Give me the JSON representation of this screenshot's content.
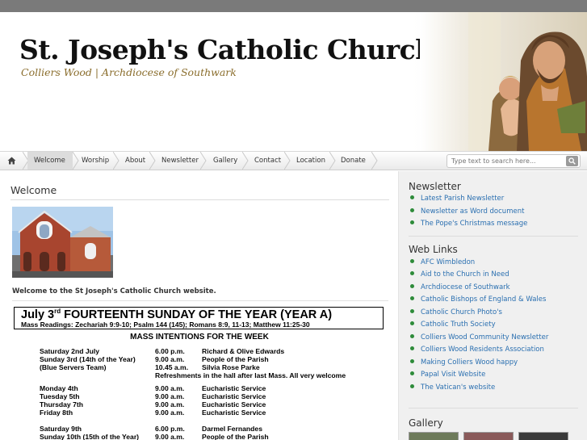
{
  "site": {
    "title": "St. Joseph's Catholic Church",
    "subtitle": "Colliers Wood | Archdiocese of Southwark"
  },
  "nav": {
    "home_icon": "home-icon",
    "items": [
      {
        "label": "Welcome",
        "active": true
      },
      {
        "label": "Worship"
      },
      {
        "label": "About"
      },
      {
        "label": "Newsletter"
      },
      {
        "label": "Gallery"
      },
      {
        "label": "Contact"
      },
      {
        "label": "Location"
      },
      {
        "label": "Donate"
      }
    ],
    "search_placeholder": "Type text to search here...",
    "search_icon": "search-icon"
  },
  "main": {
    "heading": "Welcome",
    "welcome_text": "Welcome to the St Joseph's Catholic Church website."
  },
  "bulletin": {
    "title_a": "July 3",
    "title_sup": "rd",
    "title_b": " FOURTEENTH SUNDAY OF THE YEAR (YEAR A)",
    "readings": "Mass Readings:  Zechariah 9:9-10;  Psalm 144 (145);  Romans 8:9, 11-13;  Matthew 11:25-30",
    "intentions_heading": "MASS INTENTIONS FOR THE WEEK",
    "rows": [
      {
        "day": "Saturday 2nd July",
        "time": "6.00 p.m.",
        "intention": "Richard & Olive Edwards"
      },
      {
        "day": "Sunday 3rd (14th of the Year)",
        "time": "9.00 a.m.",
        "intention": "People of the Parish"
      },
      {
        "day": "(Blue Servers Team)",
        "time": "10.45 a.m.",
        "intention": "Silvia Rose Parke"
      },
      {
        "day": "",
        "time": "",
        "intention": "Refreshments in the hall after last Mass. All very welcome"
      },
      {
        "day": "Monday 4th",
        "time": "9.00 a.m.",
        "intention": "Eucharistic Service"
      },
      {
        "day": "Tuesday 5th",
        "time": "9.00 a.m.",
        "intention": "Eucharistic Service"
      },
      {
        "day": "Thursday 7th",
        "time": "9.00 a.m.",
        "intention": "Eucharistic Service"
      },
      {
        "day": "Friday 8th",
        "time": "9.00 a.m.",
        "intention": "Eucharistic Service"
      },
      {
        "day": "Saturday 9th",
        "time": "6.00 p.m.",
        "intention": "Darmel Fernandes"
      },
      {
        "day": "Sunday 10th (15th of the Year)",
        "time": "9.00 a.m.",
        "intention": "People of the Parish"
      }
    ]
  },
  "sidebar": {
    "newsletter": {
      "heading": "Newsletter",
      "links": [
        "Latest Parish Newsletter",
        "Newsletter as Word document",
        "The Pope's Christmas message"
      ]
    },
    "weblinks": {
      "heading": "Web Links",
      "links": [
        "AFC Wimbledon",
        "Aid to the Church in Need",
        "Archdiocese of Southwark",
        "Catholic Bishops of England & Wales",
        "Catholic Church Photo's",
        "Catholic Truth Society",
        "Colliers Wood Community Newsletter",
        "Colliers Wood Residents Association",
        "Making Colliers Wood happy",
        "Papal Visit Website",
        "The Vatican's website"
      ]
    },
    "gallery": {
      "heading": "Gallery"
    }
  },
  "colors": {
    "link": "#2a6fb0",
    "bullet": "#2e8b3a",
    "subtitle": "#8a6d2c",
    "topbar": "#7a7a7a"
  }
}
